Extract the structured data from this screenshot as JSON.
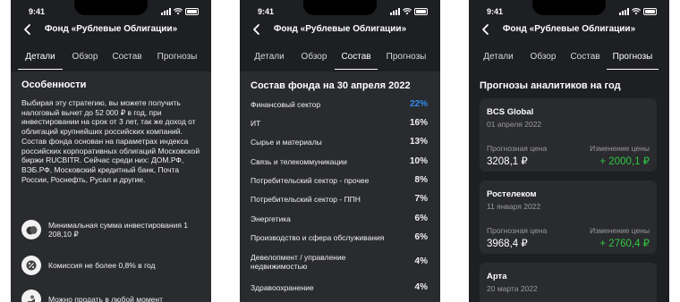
{
  "status": {
    "time": "9:41"
  },
  "header": {
    "title": "Фонд «Рублевые Облигации»"
  },
  "tabs": [
    "Детали",
    "Обзор",
    "Состав",
    "Прогнозы"
  ],
  "colors": {
    "accent_blue": "#2f8cf0",
    "positive_green": "#2ec840"
  },
  "screen1": {
    "heading": "Особенности",
    "description": "Выбирая эту стратегию, вы можете получить налоговый вычет до 52 000 ₽ в год, при инвестировании на срок от 3 лет, так же доход от облигаций крупнейших российских компаний. Состав фонда основан на параметрах индекса российских корпоративных облигаций Московской биржи RUCBITR. Сейчас среди них: ДОМ.РФ, ВЭБ.РФ, Московский кредитный банк, Почта России, Роснефть, Русал и другие.",
    "features": [
      {
        "icon": "coins-icon",
        "text": "Минимальная сумма инвестирования 1 208,10 ₽"
      },
      {
        "icon": "percent-icon",
        "text": "Комиссия не более 0,8% в год"
      },
      {
        "icon": "hand-icon",
        "text": "Можно продать в любой момент"
      }
    ]
  },
  "screen2": {
    "heading": "Состав фонда на 30 апреля 2022",
    "sectors": [
      {
        "name": "Финансовый сектор",
        "pct": "22%"
      },
      {
        "name": "ИТ",
        "pct": "16%"
      },
      {
        "name": "Сырье и материалы",
        "pct": "13%"
      },
      {
        "name": "Связь и телекоммуникации",
        "pct": "10%"
      },
      {
        "name": "Потребительский сектор - прочее",
        "pct": "8%"
      },
      {
        "name": "Потребительский сектор - ППН",
        "pct": "7%"
      },
      {
        "name": "Энергетика",
        "pct": "6%"
      },
      {
        "name": "Производство и сфера обслуживания",
        "pct": "6%"
      },
      {
        "name": "Девелопмент / управление недвижимостью",
        "pct": "4%"
      },
      {
        "name": "Здравоохранение",
        "pct": "4%"
      }
    ]
  },
  "screen3": {
    "heading": "Прогнозы аналитиков на год",
    "price_label": "Прогнозная цена",
    "change_label": "Изменение цены",
    "forecasts": [
      {
        "analyst": "BCS Global",
        "date": "01 апреля 2022",
        "price": "3208,1 ₽",
        "change": "+ 2000,1 ₽"
      },
      {
        "analyst": "Ростелеком",
        "date": "11 января 2022",
        "price": "3968,4 ₽",
        "change": "+ 2760,4 ₽"
      },
      {
        "analyst": "Арта",
        "date": "20 марта 2022"
      }
    ]
  }
}
